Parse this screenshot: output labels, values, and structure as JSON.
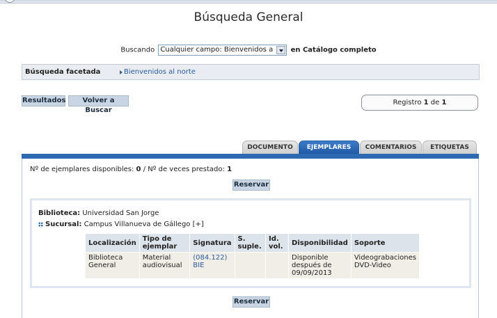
{
  "page": {
    "title": "Búsqueda General"
  },
  "search": {
    "label": "Buscando",
    "selected": "Cualquier campo: Bienvenidos al norte/",
    "scope": "en Catálogo completo"
  },
  "facets": {
    "heading": "Búsqueda facetada",
    "link": "Bienvenidos al norte"
  },
  "toolbar": {
    "results_label": "Resultados",
    "back_label": "Volver a Buscar"
  },
  "record": {
    "prefix": "Registro",
    "current": "1",
    "of": "de",
    "total": "1"
  },
  "tabs": [
    {
      "label": "DOCUMENTO",
      "active": false
    },
    {
      "label": "EJEMPLARES",
      "active": true
    },
    {
      "label": "COMENTARIOS",
      "active": false
    },
    {
      "label": "ETIQUETAS",
      "active": false
    }
  ],
  "stats": {
    "available_label": "Nº de ejemplares disponibles:",
    "available": "0",
    "separator": "/",
    "loaned_label": "Nº de veces prestado:",
    "loaned": "1"
  },
  "reserve_label": "Reservar",
  "holding": {
    "library_label": "Biblioteca",
    "library": "Universidad San Jorge",
    "branch_label": "Sucursal",
    "branch": "Campus Villanueva de Gállego",
    "expand": "[+]"
  },
  "table": {
    "headers": [
      "Localización",
      "Tipo de ejemplar",
      "Signatura",
      "S. suple.",
      "Id. vol.",
      "Disponibilidad",
      "Soporte"
    ],
    "rows": [
      {
        "location": [
          "Biblioteca",
          "General"
        ],
        "type": [
          "Material",
          "audiovisual"
        ],
        "signature": [
          "(084.122)",
          "BIE"
        ],
        "supplement": "",
        "volume": "",
        "availability": [
          "Disponible",
          "después de",
          "09/09/2013"
        ],
        "support": [
          "Videograbaciones",
          "DVD-Video"
        ]
      }
    ]
  },
  "colors": {
    "accent": "#2d69b3",
    "link": "#2a5b9a",
    "button_bg": "#c9d5e3"
  }
}
